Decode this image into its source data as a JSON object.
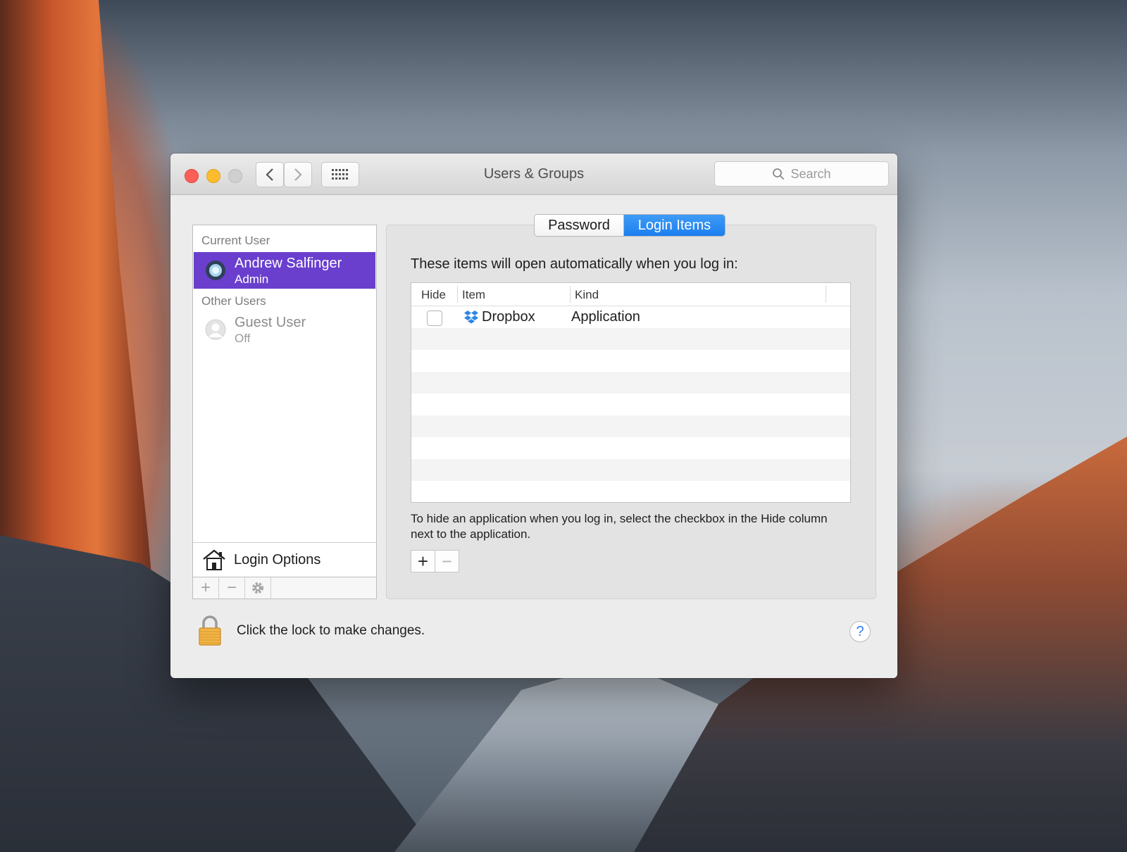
{
  "window": {
    "title": "Users & Groups",
    "search_placeholder": "Search"
  },
  "sidebar": {
    "current_user_heading": "Current User",
    "current_user": {
      "name": "Andrew Salfinger",
      "role": "Admin"
    },
    "other_users_heading": "Other Users",
    "other_users": [
      {
        "name": "Guest User",
        "status": "Off"
      }
    ],
    "login_options_label": "Login Options",
    "selection_color": "#6a3fce"
  },
  "tabs": [
    {
      "label": "Password",
      "selected": false
    },
    {
      "label": "Login Items",
      "selected": true
    }
  ],
  "login_items": {
    "intro": "These items will open automatically when you log in:",
    "columns": [
      "Hide",
      "Item",
      "Kind"
    ],
    "rows": [
      {
        "hide": false,
        "item": "Dropbox",
        "kind": "Application",
        "icon": "dropbox-icon"
      }
    ],
    "hint": "To hide an application when you log in, select the checkbox in the Hide column next to the application."
  },
  "footer": {
    "lock_text": "Click the lock to make changes.",
    "help_label": "?"
  }
}
